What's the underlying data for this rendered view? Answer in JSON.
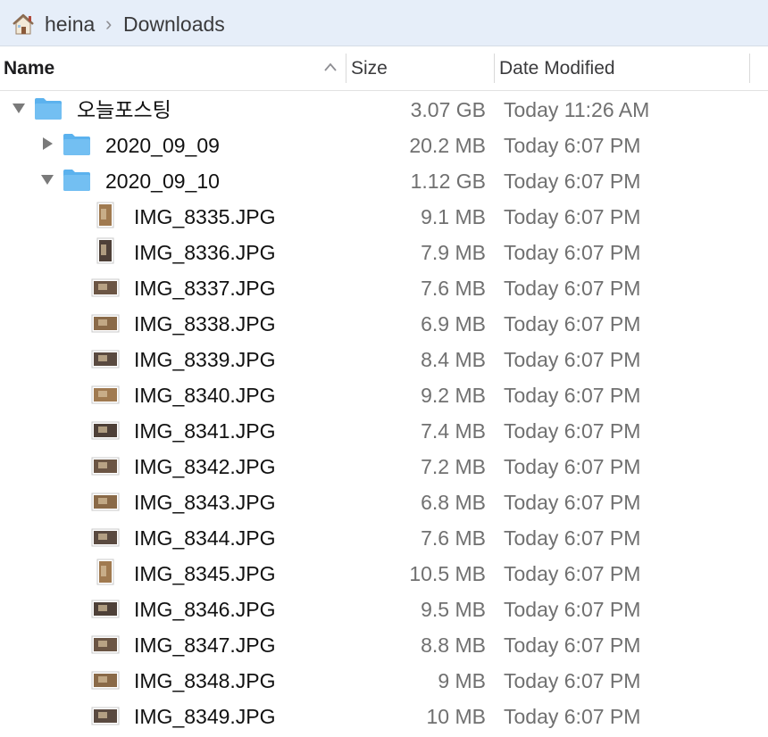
{
  "breadcrumb": {
    "home": "heina",
    "separator": "›",
    "current": "Downloads"
  },
  "columns": {
    "name": "Name",
    "size": "Size",
    "date": "Date Modified"
  },
  "rows": [
    {
      "name": "오늘포스팅",
      "size": "3.07 GB",
      "date": "Today 11:26 AM",
      "kind": "folder",
      "level": 0,
      "expanded": true
    },
    {
      "name": "2020_09_09",
      "size": "20.2 MB",
      "date": "Today 6:07 PM",
      "kind": "folder",
      "level": 1,
      "expanded": false
    },
    {
      "name": "2020_09_10",
      "size": "1.12 GB",
      "date": "Today 6:07 PM",
      "kind": "folder",
      "level": 1,
      "expanded": true
    },
    {
      "name": "IMG_8335.JPG",
      "size": "9.1 MB",
      "date": "Today 6:07 PM",
      "kind": "image",
      "orientation": "portrait",
      "level": 2
    },
    {
      "name": "IMG_8336.JPG",
      "size": "7.9 MB",
      "date": "Today 6:07 PM",
      "kind": "image",
      "orientation": "portrait",
      "level": 2
    },
    {
      "name": "IMG_8337.JPG",
      "size": "7.6 MB",
      "date": "Today 6:07 PM",
      "kind": "image",
      "orientation": "landscape",
      "level": 2
    },
    {
      "name": "IMG_8338.JPG",
      "size": "6.9 MB",
      "date": "Today 6:07 PM",
      "kind": "image",
      "orientation": "landscape",
      "level": 2
    },
    {
      "name": "IMG_8339.JPG",
      "size": "8.4 MB",
      "date": "Today 6:07 PM",
      "kind": "image",
      "orientation": "landscape",
      "level": 2
    },
    {
      "name": "IMG_8340.JPG",
      "size": "9.2 MB",
      "date": "Today 6:07 PM",
      "kind": "image",
      "orientation": "landscape",
      "level": 2
    },
    {
      "name": "IMG_8341.JPG",
      "size": "7.4 MB",
      "date": "Today 6:07 PM",
      "kind": "image",
      "orientation": "landscape",
      "level": 2
    },
    {
      "name": "IMG_8342.JPG",
      "size": "7.2 MB",
      "date": "Today 6:07 PM",
      "kind": "image",
      "orientation": "landscape",
      "level": 2
    },
    {
      "name": "IMG_8343.JPG",
      "size": "6.8 MB",
      "date": "Today 6:07 PM",
      "kind": "image",
      "orientation": "landscape",
      "level": 2
    },
    {
      "name": "IMG_8344.JPG",
      "size": "7.6 MB",
      "date": "Today 6:07 PM",
      "kind": "image",
      "orientation": "landscape",
      "level": 2
    },
    {
      "name": "IMG_8345.JPG",
      "size": "10.5 MB",
      "date": "Today 6:07 PM",
      "kind": "image",
      "orientation": "portrait",
      "level": 2
    },
    {
      "name": "IMG_8346.JPG",
      "size": "9.5 MB",
      "date": "Today 6:07 PM",
      "kind": "image",
      "orientation": "landscape",
      "level": 2
    },
    {
      "name": "IMG_8347.JPG",
      "size": "8.8 MB",
      "date": "Today 6:07 PM",
      "kind": "image",
      "orientation": "landscape",
      "level": 2
    },
    {
      "name": "IMG_8348.JPG",
      "size": "9 MB",
      "date": "Today 6:07 PM",
      "kind": "image",
      "orientation": "landscape",
      "level": 2
    },
    {
      "name": "IMG_8349.JPG",
      "size": "10 MB",
      "date": "Today 6:07 PM",
      "kind": "image",
      "orientation": "landscape",
      "level": 2
    }
  ],
  "icons": {
    "home": "home-icon",
    "sort": "sort-ascending-icon",
    "folder": "folder-icon",
    "image": "image-thumbnail-icon",
    "expanded": "disclosure-triangle-down-icon",
    "collapsed": "disclosure-triangle-right-icon"
  },
  "colors": {
    "pathbar_bg": "#e6eef9",
    "folder": "#73bff2",
    "secondary_text": "#707070"
  }
}
